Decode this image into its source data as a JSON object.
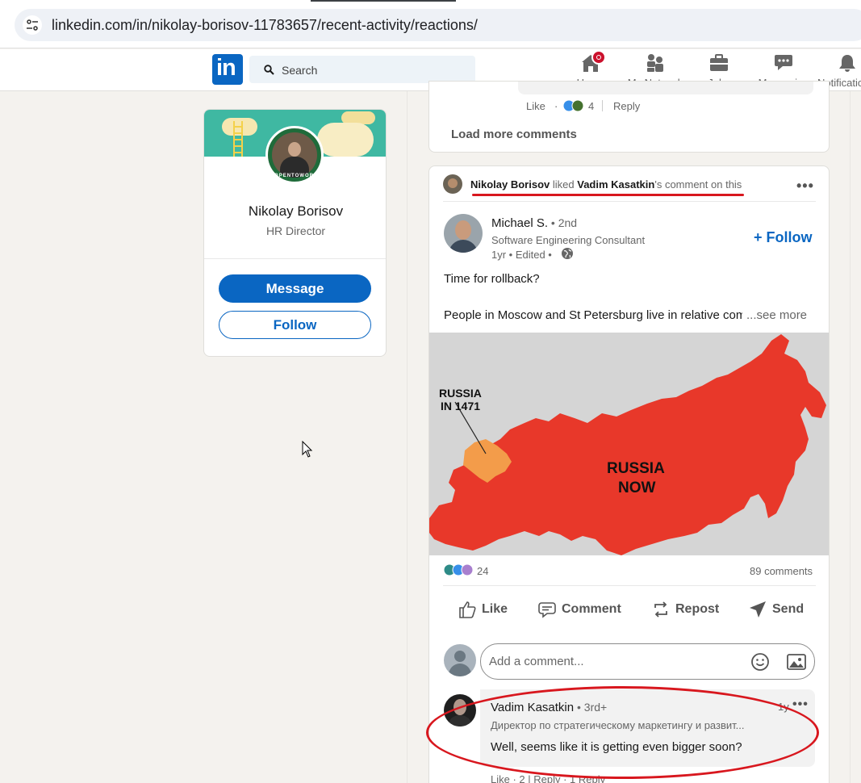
{
  "browser": {
    "url": "linkedin.com/in/nikolay-borisov-11783657/recent-activity/reactions/"
  },
  "nav": {
    "logo": "in",
    "search_placeholder": "Search",
    "items": [
      {
        "label": "Home",
        "icon": "home-icon"
      },
      {
        "label": "My Network",
        "icon": "network-icon"
      },
      {
        "label": "Jobs",
        "icon": "jobs-icon"
      },
      {
        "label": "Messaging",
        "icon": "messaging-icon"
      },
      {
        "label": "Notifications",
        "icon": "bell-icon"
      }
    ]
  },
  "profile": {
    "name": "Nikolay Borisov",
    "title": "HR Director",
    "avatar_ring_text": "#OPENTOWORK",
    "message_label": "Message",
    "follow_label": "Follow"
  },
  "prev_card": {
    "like_label": "Like",
    "dot": "·",
    "reaction_count": "4",
    "reply_label": "Reply",
    "load_more": "Load more comments"
  },
  "activity": {
    "header": {
      "actor": "Nikolay Borisov",
      "verb": " liked ",
      "target": "Vadim Kasatkin",
      "suffix": "'s comment on this"
    },
    "author": {
      "name": "Michael S.",
      "degree": " • 2nd",
      "headline": "Software Engineering Consultant",
      "meta": "1yr • Edited •"
    },
    "follow_label": "+ Follow",
    "text_line1": "Time for rollback?",
    "text_line2": "People in Moscow and St Petersburg live in relative comfort",
    "see_more": "...see more",
    "image": {
      "label_old_line1": "RUSSIA",
      "label_old_line2": "IN 1471",
      "label_now_line1": "RUSSIA",
      "label_now_line2": "NOW",
      "colors": {
        "now": "#e8382a",
        "old": "#f39c4a",
        "bg": "#d5d5d5"
      }
    },
    "reactions_count": "24",
    "comments_count": "89 comments",
    "actions": {
      "like": "Like",
      "comment": "Comment",
      "repost": "Repost",
      "send": "Send"
    },
    "comment_placeholder": "Add a comment...",
    "comment": {
      "author": "Vadim Kasatkin",
      "degree": " • 3rd+",
      "time": "1y",
      "headline": "Директор по стратегическому маркетингу и развит...",
      "text": "Well, seems like it is getting even bigger soon?",
      "actions_text": "Like · 2 | Reply · 1 Reply"
    }
  },
  "colors": {
    "brand": "#0a66c2",
    "highlight": "#d8171e"
  }
}
